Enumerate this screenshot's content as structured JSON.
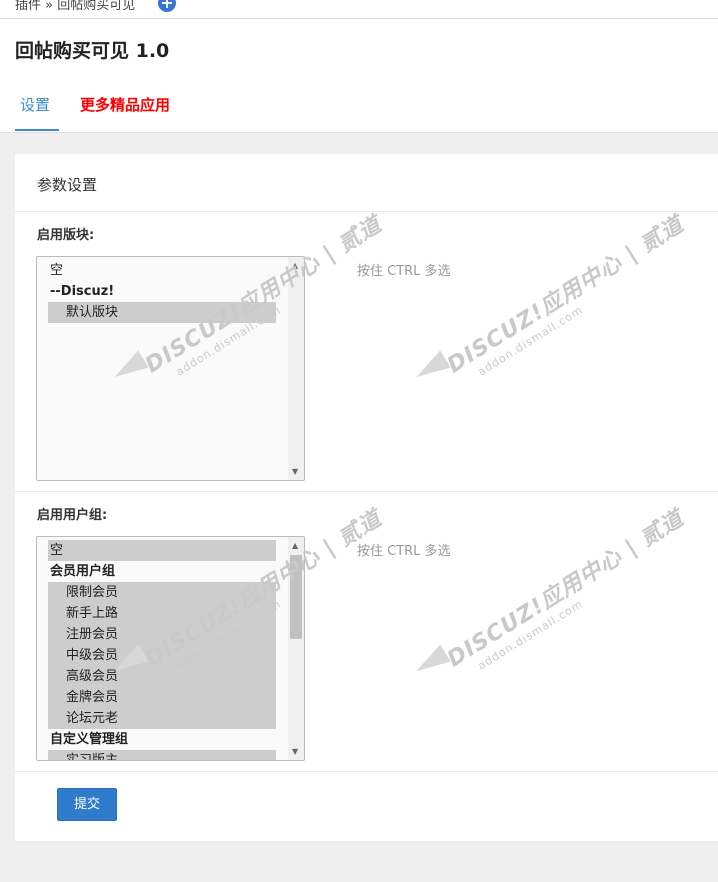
{
  "breadcrumb": "插件 » 回帖购买可见",
  "page_title": "回帖购买可见 1.0",
  "tabs": [
    {
      "label": "设置"
    },
    {
      "label": "更多精品应用"
    }
  ],
  "panel_title": "参数设置",
  "forums_field": {
    "label": "启用版块:",
    "hint": "按住 CTRL 多选",
    "options": [
      {
        "label": "空",
        "kind": "option",
        "selected": false
      },
      {
        "label": "--Discuz!",
        "kind": "group",
        "selected": false
      },
      {
        "label": "默认版块",
        "kind": "child",
        "selected": true
      }
    ]
  },
  "groups_field": {
    "label": "启用用户组:",
    "hint": "按住 CTRL 多选",
    "options": [
      {
        "label": "空",
        "kind": "option",
        "selected": true
      },
      {
        "label": "会员用户组",
        "kind": "group",
        "selected": false
      },
      {
        "label": "限制会员",
        "kind": "child",
        "selected": true
      },
      {
        "label": "新手上路",
        "kind": "child",
        "selected": true
      },
      {
        "label": "注册会员",
        "kind": "child",
        "selected": true
      },
      {
        "label": "中级会员",
        "kind": "child",
        "selected": true
      },
      {
        "label": "高级会员",
        "kind": "child",
        "selected": true
      },
      {
        "label": "金牌会员",
        "kind": "child",
        "selected": true
      },
      {
        "label": "论坛元老",
        "kind": "child",
        "selected": true
      },
      {
        "label": "自定义管理组",
        "kind": "group",
        "selected": false
      },
      {
        "label": "实习版主",
        "kind": "child",
        "selected": true
      }
    ]
  },
  "submit_label": "提交",
  "watermark": {
    "brand": "DISCUZ!应用中心 | 贰道",
    "site": "addon.dismall.com"
  },
  "colors": {
    "accent": "#3d8ad1",
    "promo": "#ff0000",
    "button": "#2f7ccd"
  }
}
